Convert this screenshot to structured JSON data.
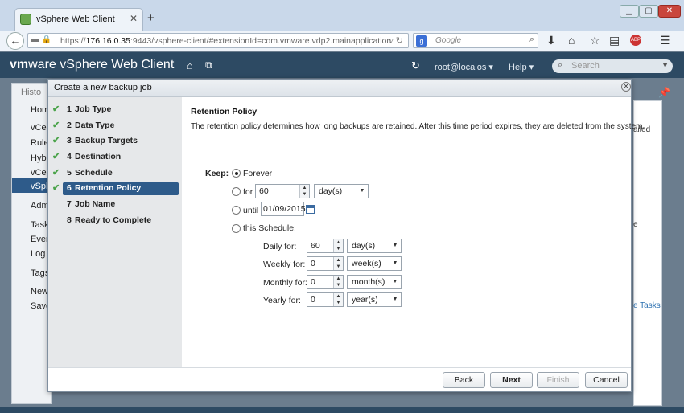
{
  "browser": {
    "tab_title": "vSphere Web Client",
    "url_prefix": "https://",
    "url_host": "176.16.0.35",
    "url_rest": ":9443/vsphere-client/#extensionId=com.vmware.vdp2.mainapplication",
    "search_placeholder": "Google",
    "new_tab": "+",
    "addon_badge": "ABP"
  },
  "header": {
    "logo_vm": "vm",
    "logo_ware": "ware",
    "title": " vSphere Web Client",
    "user": "root@localos",
    "help": "Help",
    "search_placeholder": "Search"
  },
  "background": {
    "left_items": [
      "Histo",
      "Hom",
      "vCen",
      "Rule",
      "Hybr",
      "vCen",
      "vSph",
      "Admi",
      "Task",
      "Even",
      "Log B",
      "Tags",
      "New",
      "Save"
    ],
    "right_items": [
      "ailed",
      "e",
      "e Tasks"
    ]
  },
  "dialog": {
    "title": "Create a new backup job",
    "steps": [
      {
        "num": "1",
        "label": "Job Type",
        "done": true
      },
      {
        "num": "2",
        "label": "Data Type",
        "done": true
      },
      {
        "num": "3",
        "label": "Backup Targets",
        "done": true
      },
      {
        "num": "4",
        "label": "Destination",
        "done": true
      },
      {
        "num": "5",
        "label": "Schedule",
        "done": true
      },
      {
        "num": "6",
        "label": "Retention Policy",
        "done": true,
        "active": true
      },
      {
        "num": "7",
        "label": "Job Name",
        "done": false
      },
      {
        "num": "8",
        "label": "Ready to Complete",
        "done": false
      }
    ],
    "content": {
      "title": "Retention Policy",
      "description": "The retention policy determines how long backups are retained.  After this time period expires, they are deleted from the system.",
      "keep_label": "Keep:",
      "opt_forever": "Forever",
      "opt_for": "for",
      "for_value": "60",
      "for_unit": "day(s)",
      "opt_until": "until",
      "until_value": "01/09/2015",
      "opt_schedule": "this Schedule:",
      "schedule": [
        {
          "label": "Daily for:",
          "value": "60",
          "unit": "day(s)"
        },
        {
          "label": "Weekly for:",
          "value": "0",
          "unit": "week(s)"
        },
        {
          "label": "Monthly for:",
          "value": "0",
          "unit": "month(s)"
        },
        {
          "label": "Yearly for:",
          "value": "0",
          "unit": "year(s)"
        }
      ],
      "selected": "Forever"
    },
    "buttons": {
      "back": "Back",
      "next": "Next",
      "finish": "Finish",
      "cancel": "Cancel"
    }
  }
}
